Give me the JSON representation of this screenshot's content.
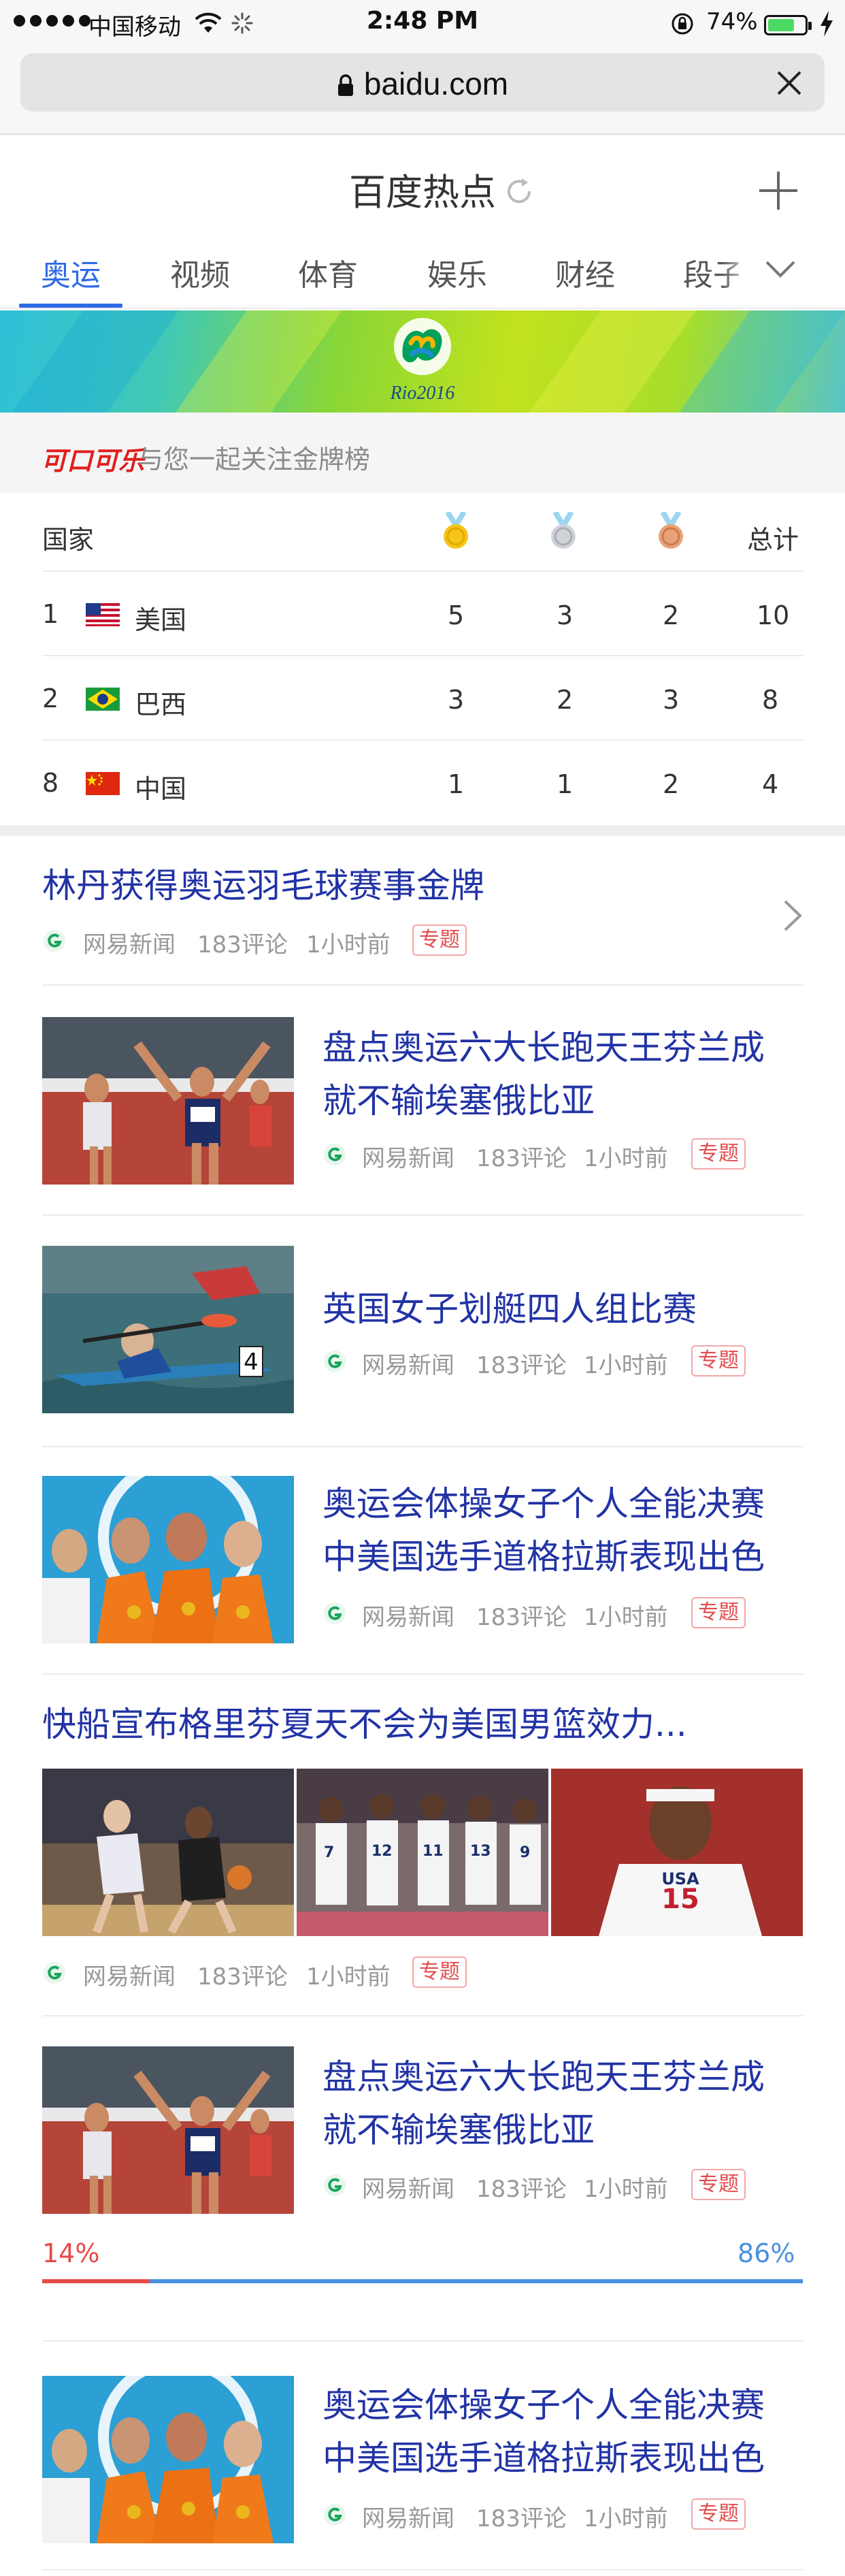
{
  "status_bar": {
    "carrier": "中国移动",
    "time": "2:48 PM",
    "battery": "74%",
    "battery_level": 0.74
  },
  "browser": {
    "url": "baidu.com"
  },
  "header": {
    "title": "百度热点"
  },
  "tabs": [
    {
      "label": "奥运",
      "active": true
    },
    {
      "label": "视频"
    },
    {
      "label": "体育"
    },
    {
      "label": "娱乐"
    },
    {
      "label": "财经"
    },
    {
      "label": "段子"
    }
  ],
  "banner": {
    "logo_text": "Rio2016"
  },
  "sponsor": {
    "logo": "可口可乐",
    "text": "与您一起关注金牌榜"
  },
  "medal_table": {
    "columns": {
      "country": "国家",
      "gold": "gold-medal-icon",
      "silver": "silver-medal-icon",
      "bronze": "bronze-medal-icon",
      "total": "总计"
    },
    "rows": [
      {
        "rank": "1",
        "flag": "usa-flag-icon",
        "country": "美国",
        "gold": "5",
        "silver": "3",
        "bronze": "2",
        "total": "10"
      },
      {
        "rank": "2",
        "flag": "brazil-flag-icon",
        "country": "巴西",
        "gold": "3",
        "silver": "2",
        "bronze": "3",
        "total": "8"
      },
      {
        "rank": "8",
        "flag": "china-flag-icon",
        "country": "中国",
        "gold": "1",
        "silver": "1",
        "bronze": "2",
        "total": "4"
      }
    ]
  },
  "news": [
    {
      "title": "林丹获得奥运羽毛球赛事金牌",
      "source": "网易新闻",
      "comments": "183评论",
      "time": "1小时前",
      "tag": "专题"
    },
    {
      "title_line1": "盘点奥运六大长跑天王芬兰成",
      "title_line2": "就不输埃塞俄比亚",
      "source": "网易新闻",
      "comments": "183评论",
      "time": "1小时前",
      "tag": "专题",
      "thumb": "runners-photo"
    },
    {
      "title": "英国女子划艇四人组比赛",
      "source": "网易新闻",
      "comments": "183评论",
      "time": "1小时前",
      "tag": "专题",
      "thumb": "kayak-photo"
    },
    {
      "title_line1": "奥运会体操女子个人全能决赛",
      "title_line2": "中美国选手道格拉斯表现出色",
      "source": "网易新闻",
      "comments": "183评论",
      "time": "1小时前",
      "tag": "专题",
      "thumb": "gymnasts-photo"
    },
    {
      "title": "快船宣布格里芬夏天不会为美国男篮效力...",
      "source": "网易新闻",
      "comments": "183评论",
      "time": "1小时前",
      "tag": "专题",
      "thumbs": [
        "basketball-game-photo",
        "usa-team-photo",
        "basketball-player-photo"
      ]
    },
    {
      "title_line1": "盘点奥运六大长跑天王芬兰成",
      "title_line2": "就不输埃塞俄比亚",
      "source": "网易新闻",
      "comments": "183评论",
      "time": "1小时前",
      "tag": "专题",
      "thumb": "runners-photo",
      "vote": {
        "left": "14%",
        "right": "86%",
        "left_share": 0.14,
        "left_color": "#e64a4a",
        "right_color": "#4a8fe0"
      }
    },
    {
      "title_line1": "奥运会体操女子个人全能决赛",
      "title_line2": "中美国选手道格拉斯表现出色",
      "source": "网易新闻",
      "comments": "183评论",
      "time": "1小时前",
      "tag": "专题",
      "thumb": "gymnasts-photo"
    }
  ],
  "colors": {
    "accent": "#2e6be6",
    "headline": "#2233a5",
    "tag": "#e24b4b"
  }
}
